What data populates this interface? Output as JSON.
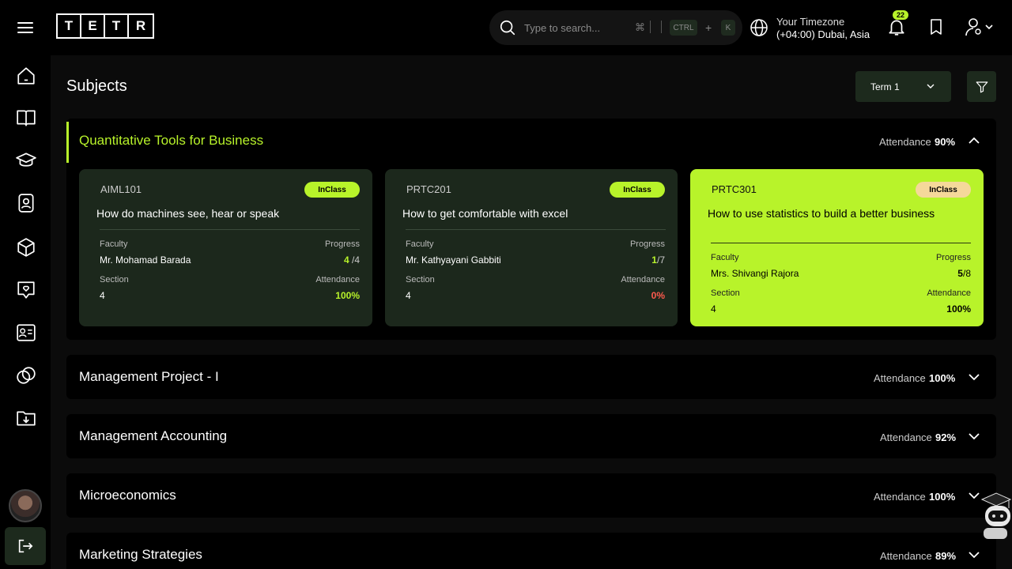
{
  "header": {
    "logo_letters": [
      "T",
      "E",
      "T",
      "R"
    ],
    "search": {
      "placeholder": "Type to search...",
      "shortcut_cmd": "⌘",
      "shortcut_ctrl": "CTRL",
      "shortcut_plus": "+",
      "shortcut_key": "K"
    },
    "timezone": {
      "label": "Your Timezone",
      "value": "(+04:00) Dubai, Asia"
    },
    "notifications_count": "22"
  },
  "sidebar": {
    "items": [
      "home-icon",
      "book-icon",
      "graduation-cap-icon",
      "id-badge-icon",
      "cube-icon",
      "heart-message-icon",
      "contact-card-icon",
      "rings-icon",
      "folder-download-icon"
    ],
    "logout": "logout-icon"
  },
  "page": {
    "title": "Subjects",
    "term": "Term 1"
  },
  "subjects": [
    {
      "name": "Quantitative Tools for Business",
      "attendance_label": "Attendance",
      "attendance": "90%",
      "expanded": true,
      "cards": [
        {
          "code": "AIML101",
          "badge": "InClass",
          "title": "How do machines see, hear or speak",
          "faculty_label": "Faculty",
          "faculty": "Mr. Mohamad Barada",
          "progress_label": "Progress",
          "progress_done": "4",
          "progress_total": "/4",
          "section_label": "Section",
          "section": "4",
          "attendance_label": "Attendance",
          "attendance": "100%"
        },
        {
          "code": "PRTC201",
          "badge": "InClass",
          "title": "How to get comfortable with excel",
          "faculty_label": "Faculty",
          "faculty": "Mr. Kathyayani Gabbiti",
          "progress_label": "Progress",
          "progress_done": "1",
          "progress_total": "/7",
          "section_label": "Section",
          "section": "4",
          "attendance_label": "Attendance",
          "attendance": "0%"
        },
        {
          "code": "PRTC301",
          "badge": "InClass",
          "title": "How to use statistics to build a better business",
          "faculty_label": "Faculty",
          "faculty": "Mrs. Shivangi Rajora",
          "progress_label": "Progress",
          "progress_done": "5",
          "progress_total": "/8",
          "section_label": "Section",
          "section": "4",
          "attendance_label": "Attendance",
          "attendance": "100%"
        }
      ]
    },
    {
      "name": "Management Project - I",
      "attendance_label": "Attendance",
      "attendance": "100%",
      "expanded": false
    },
    {
      "name": "Management Accounting",
      "attendance_label": "Attendance",
      "attendance": "92%",
      "expanded": false
    },
    {
      "name": "Microeconomics",
      "attendance_label": "Attendance",
      "attendance": "100%",
      "expanded": false
    },
    {
      "name": "Marketing Strategies",
      "attendance_label": "Attendance",
      "attendance": "89%",
      "expanded": false
    }
  ],
  "colors": {
    "accent": "#b8f32a",
    "card_bg": "#1c281c",
    "danger": "#ff5a4e"
  }
}
